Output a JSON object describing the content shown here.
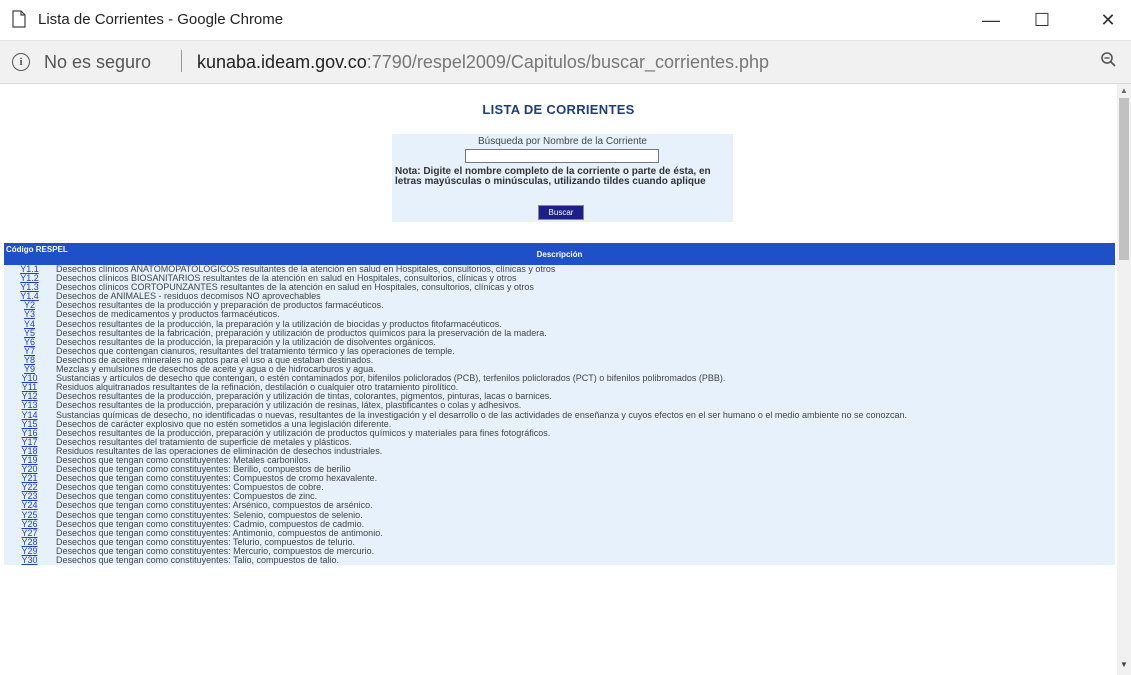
{
  "window": {
    "title": "Lista de Corrientes - Google Chrome",
    "controls": {
      "minimize": "—",
      "maximize": "☐",
      "close": "✕"
    }
  },
  "address_bar": {
    "security_label": "No es seguro",
    "url_domain": "kunaba.ideam.gov.co",
    "url_rest": ":7790/respel2009/Capitulos/buscar_corrientes.php",
    "info_icon": "info-icon",
    "zoom_icon": "zoom-icon"
  },
  "page": {
    "heading": "LISTA DE CORRIENTES",
    "search": {
      "label": "Búsqueda por Nombre de la Corriente",
      "value": "",
      "note": "Nota: Digite el nombre completo de la corriente o parte de ésta, en letras mayúsculas o minúsculas, utilizando tildes cuando aplique",
      "button": "Buscar"
    },
    "table": {
      "header_code": "Código RESPEL",
      "header_desc": "Descripción",
      "rows": [
        {
          "code": "Y1.1",
          "desc": "Desechos clínicos ANATOMOPATOLOGICOS resultantes de la atención en salud en Hospitales, consultorios, clínicas y otros"
        },
        {
          "code": "Y1.2",
          "desc": "Desechos clínicos BIOSANITARIOS resultantes de la atención en salud en Hospitales, consultorios, clínicas y otros"
        },
        {
          "code": "Y1.3",
          "desc": "Desechos clínicos CORTOPUNZANTES resultantes de la atención en salud en Hospitales, consultorios, clínicas y otros"
        },
        {
          "code": "Y1.4",
          "desc": "Desechos de ANIMALES - residuos decomisos NO aprovechables"
        },
        {
          "code": "Y2",
          "desc": "Desechos resultantes de la producción y preparación de productos farmacéuticos."
        },
        {
          "code": "Y3",
          "desc": "Desechos de medicamentos y productos farmacéuticos."
        },
        {
          "code": "Y4",
          "desc": "Desechos resultantes de la producción, la preparación y la utilización de biocidas y productos fitofarmacéuticos."
        },
        {
          "code": "Y5",
          "desc": "Desechos resultantes de la fabricación, preparación y utilización de productos químicos para la preservación de la madera."
        },
        {
          "code": "Y6",
          "desc": "Desechos resultantes de la producción, la preparación y la utilización de disolventes orgánicos."
        },
        {
          "code": "Y7",
          "desc": "Desechos que contengan cianuros, resultantes del tratamiento térmico y las operaciones de temple."
        },
        {
          "code": "Y8",
          "desc": "Desechos de aceites minerales no aptos para el uso a que estaban destinados."
        },
        {
          "code": "Y9",
          "desc": "Mezclas y emulsiones de desechos de aceite y agua o de hidrocarburos y agua."
        },
        {
          "code": "Y10",
          "desc": "Sustancias y artículos de desecho que contengan, o estén contaminados por, bifenilos policlorados (PCB), terfenilos policlorados (PCT) o bifenilos polibromados (PBB)."
        },
        {
          "code": "Y11",
          "desc": "Residuos alquitranados resultantes de la refinación, destilación o cualquier otro tratamiento pirolítico."
        },
        {
          "code": "Y12",
          "desc": "Desechos resultantes de la producción, preparación y utilización de tintas, colorantes, pigmentos, pinturas, lacas o barnices."
        },
        {
          "code": "Y13",
          "desc": "Desechos resultantes de la producción, preparación y utilización de resinas, látex, plastificantes o colas y adhesivos."
        },
        {
          "code": "Y14",
          "desc": "Sustancias químicas de desecho, no identificadas o nuevas, resultantes de la investigación y el desarrollo o de las actividades de enseñanza y cuyos efectos en el ser humano o el medio ambiente no se conozcan."
        },
        {
          "code": "Y15",
          "desc": "Desechos de carácter explosivo que no estén sometidos a una legislación diferente."
        },
        {
          "code": "Y16",
          "desc": "Desechos resultantes de la producción, preparación y utilización de productos químicos y materiales para fines fotográficos."
        },
        {
          "code": "Y17",
          "desc": "Desechos resultantes del tratamiento de superficie de metales y plásticos."
        },
        {
          "code": "Y18",
          "desc": "Residuos resultantes de las operaciones de eliminación de desechos industriales."
        },
        {
          "code": "Y19",
          "desc": "Desechos que tengan como constituyentes: Metales carbonilos."
        },
        {
          "code": "Y20",
          "desc": "Desechos que tengan como constituyentes: Berilio, compuestos de berilio"
        },
        {
          "code": "Y21",
          "desc": "Desechos que tengan como constituyentes: Compuestos de cromo hexavalente."
        },
        {
          "code": "Y22",
          "desc": "Desechos que tengan como constituyentes: Compuestos de cobre."
        },
        {
          "code": "Y23",
          "desc": "Desechos que tengan como constituyentes: Compuestos de zinc."
        },
        {
          "code": "Y24",
          "desc": "Desechos que tengan como constituyentes: Arsénico, compuestos de arsénico."
        },
        {
          "code": "Y25",
          "desc": "Desechos que tengan como constituyentes: Selenio, compuestos de selenio."
        },
        {
          "code": "Y26",
          "desc": "Desechos que tengan como constituyentes: Cadmio, compuestos de cadmio."
        },
        {
          "code": "Y27",
          "desc": "Desechos que tengan como constituyentes: Antimonio, compuestos de antimonio."
        },
        {
          "code": "Y28",
          "desc": "Desechos que tengan como constituyentes: Telurio, compuestos de telurio."
        },
        {
          "code": "Y29",
          "desc": "Desechos que tengan como constituyentes: Mercurio, compuestos de mercurio."
        },
        {
          "code": "Y30",
          "desc": "Desechos que tengan como constituyentes: Talio, compuestos de talio."
        }
      ]
    }
  },
  "colors": {
    "header_blue": "#2050c8",
    "row_bg": "#e6f1fb",
    "link": "#1f3fc0",
    "button": "#1b1f8a"
  }
}
